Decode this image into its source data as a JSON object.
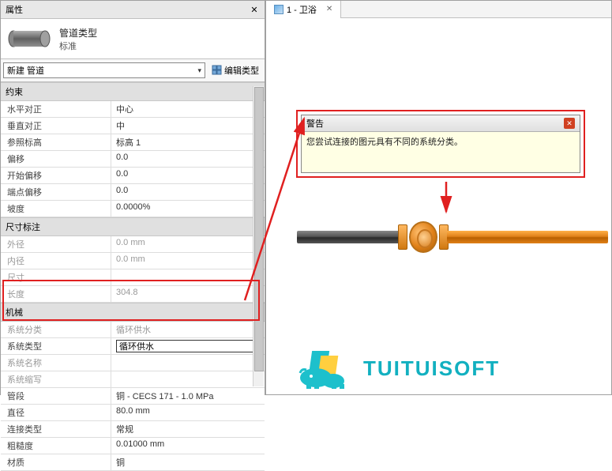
{
  "panel": {
    "title": "属性"
  },
  "type": {
    "name": "管道类型",
    "style": "标准"
  },
  "selector": {
    "label": "新建 管道",
    "edit_type": "编辑类型"
  },
  "sections": {
    "constraints": {
      "title": "约束",
      "rows": [
        {
          "k": "水平对正",
          "v": "中心"
        },
        {
          "k": "垂直对正",
          "v": "中"
        },
        {
          "k": "参照标高",
          "v": "标高 1"
        },
        {
          "k": "偏移",
          "v": "0.0"
        },
        {
          "k": "开始偏移",
          "v": "0.0"
        },
        {
          "k": "端点偏移",
          "v": "0.0"
        },
        {
          "k": "坡度",
          "v": "0.0000%"
        }
      ]
    },
    "dimensions": {
      "title": "尺寸标注",
      "rows": [
        {
          "k": "外径",
          "v": "0.0 mm",
          "dim": true
        },
        {
          "k": "内径",
          "v": "0.0 mm",
          "dim": true
        },
        {
          "k": "尺寸",
          "v": "",
          "dim": true
        },
        {
          "k": "长度",
          "v": "304.8",
          "dim": true
        }
      ]
    },
    "mechanical": {
      "title": "机械",
      "rows": [
        {
          "k": "系统分类",
          "v": "循环供水",
          "dim": true
        },
        {
          "k": "系统类型",
          "v": "循环供水",
          "input": true
        },
        {
          "k": "系统名称",
          "v": "",
          "dim": true
        },
        {
          "k": "系统缩写",
          "v": "",
          "dim": true
        },
        {
          "k": "管段",
          "v": "铜 - CECS 171 - 1.0 MPa"
        },
        {
          "k": "直径",
          "v": "80.0 mm"
        },
        {
          "k": "连接类型",
          "v": "常规"
        },
        {
          "k": "粗糙度",
          "v": "0.01000 mm"
        },
        {
          "k": "材质",
          "v": "铜"
        }
      ]
    }
  },
  "tab": {
    "label": "1 - 卫浴",
    "close": "✕"
  },
  "warning": {
    "title": "警告",
    "message": "您尝试连接的图元具有不同的系统分类。"
  },
  "logo": {
    "text": "TUITUISOFT"
  },
  "icons": {
    "close": "✕",
    "chevron_down": "▾",
    "section_collapse": "⌄",
    "up": "▴",
    "down": "▾",
    "info": "ℹ",
    "speak": "🔊"
  },
  "colors": {
    "highlight": "#e02020",
    "brand": "#12b0c0",
    "pipe_copper": "#e08018"
  }
}
